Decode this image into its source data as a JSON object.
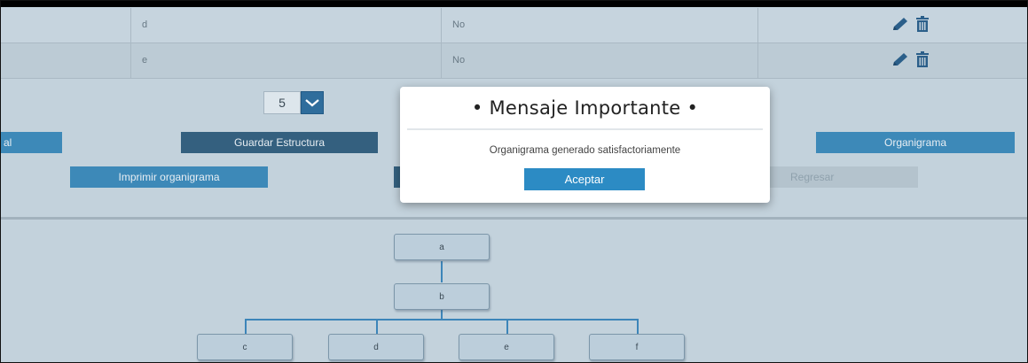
{
  "table": {
    "rows": [
      {
        "name": "d",
        "flag": "No"
      },
      {
        "name": "e",
        "flag": "No"
      }
    ],
    "action_icons": [
      "pencil-icon",
      "trash-icon"
    ]
  },
  "controls": {
    "page_size_value": "5",
    "partial_button_label": "al",
    "guardar_label": "Guardar Estructura",
    "organigrama_label": "Organigrama",
    "imprimir_label": "Imprimir organigrama",
    "regresar_label": "Regresar"
  },
  "org_chart": {
    "root": "a",
    "level1": "b",
    "children": [
      "c",
      "d",
      "e",
      "f"
    ]
  },
  "modal": {
    "title": "• Mensaje Importante •",
    "message": "Organigrama generado satisfactoriamente",
    "accept_label": "Aceptar"
  },
  "colors": {
    "background": "#c3d2dc",
    "primary_button": "#3d89b8",
    "dark_button": "#34607f",
    "modal_button": "#2c8bc4",
    "connector": "#3c85b9",
    "icon": "#2b5f8a"
  }
}
